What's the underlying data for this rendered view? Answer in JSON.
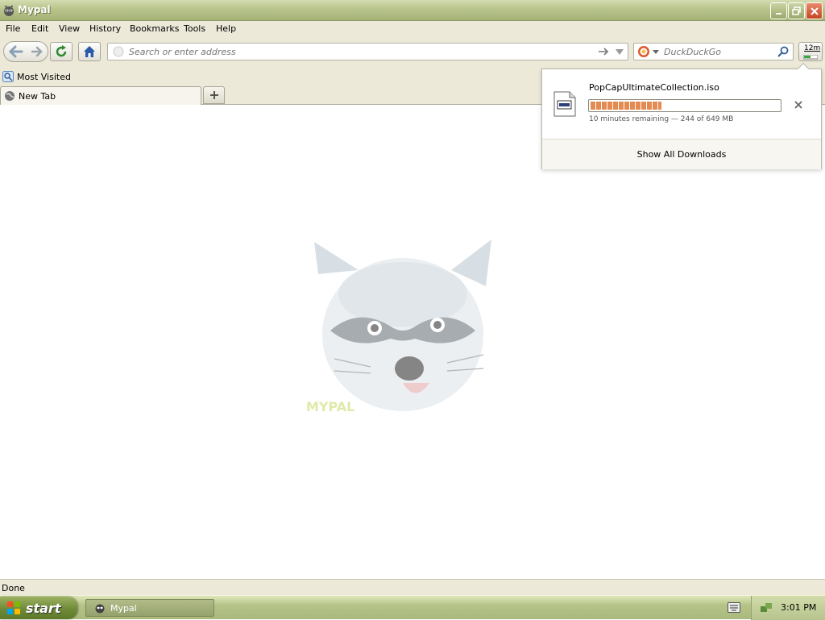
{
  "window": {
    "title": "Mypal",
    "icon": "raccoon-icon"
  },
  "menu": [
    "File",
    "Edit",
    "View",
    "History",
    "Bookmarks",
    "Tools",
    "Help"
  ],
  "navbar": {
    "url_placeholder": "Search or enter address",
    "search_engine": "DuckDuckGo",
    "search_placeholder": "DuckDuckGo",
    "downloads_button_label": "12m"
  },
  "bookmarks": {
    "items": [
      "Most Visited"
    ]
  },
  "tabs": [
    {
      "label": "New Tab",
      "active": true
    }
  ],
  "content": {
    "logo_text": "MYPAL"
  },
  "downloads": {
    "filename": "PopCapUltimateCollection.iso",
    "progress_fraction": 0.376,
    "status": "10 minutes remaining — 244 of 649 MB",
    "show_all_label": "Show All Downloads"
  },
  "statusbar": {
    "text": "Done"
  },
  "taskbar": {
    "start_label": "start",
    "tasks": [
      "Mypal"
    ],
    "clock": "3:01 PM"
  },
  "colors": {
    "titlebar": "#b8c48c",
    "chrome": "#ece9d8",
    "progress": "#e58b52",
    "taskbar": "#b6c488"
  }
}
